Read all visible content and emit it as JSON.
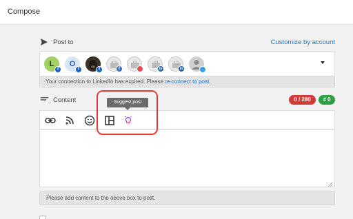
{
  "header": {
    "title": "Compose"
  },
  "post_to": {
    "label": "Post to",
    "customize_link": "Customize by account"
  },
  "accounts": [
    {
      "initial": "L",
      "bg": "#a3cf63",
      "fg": "#2a2a2a",
      "badge": "f",
      "badge_kind": "fb"
    },
    {
      "initial": "O",
      "bg": "#dbe6f5",
      "fg": "#1c5fb8",
      "badge": "f",
      "badge_kind": "fb"
    },
    {
      "initial": "",
      "bg": "#3b3326",
      "fg": "#fff",
      "badge": "f",
      "badge_kind": "fb",
      "photo": true
    },
    {
      "initial": "",
      "bg": "#e8e8e8",
      "fg": "#999",
      "badge": "f",
      "badge_kind": "gfb",
      "briefcase": true
    },
    {
      "initial": "",
      "bg": "#e8e8e8",
      "fg": "#999",
      "badge": "",
      "badge_kind": "ig",
      "briefcase": true
    },
    {
      "initial": "",
      "bg": "#e8e8e8",
      "fg": "#999",
      "badge": "in",
      "badge_kind": "li",
      "briefcase": true
    },
    {
      "initial": "",
      "bg": "#e8e8e8",
      "fg": "#999",
      "badge": "in",
      "badge_kind": "li",
      "briefcase": true
    },
    {
      "initial": "",
      "bg": "#d0d0d0",
      "fg": "#888",
      "badge": "",
      "badge_kind": "tw",
      "person": true
    }
  ],
  "notice": {
    "text": "Your connection to LinkedIn has expired. Please ",
    "link": "re-connect to post",
    "suffix": "."
  },
  "content": {
    "label": "Content",
    "char_count": "0 / 280",
    "hashtag_count": "# 0",
    "tooltip": "Suggest post",
    "textarea_value": "",
    "helper": "Please add content to the above box to post."
  },
  "toolbar": {
    "tools": [
      "link-icon",
      "rss-icon",
      "emoji-icon",
      "layout-icon",
      "lightbulb-icon"
    ]
  },
  "colors": {
    "accent_link": "#1a73c8",
    "counter_red": "#d33b3b",
    "counter_green": "#2ea043",
    "highlight": "#e53935"
  }
}
